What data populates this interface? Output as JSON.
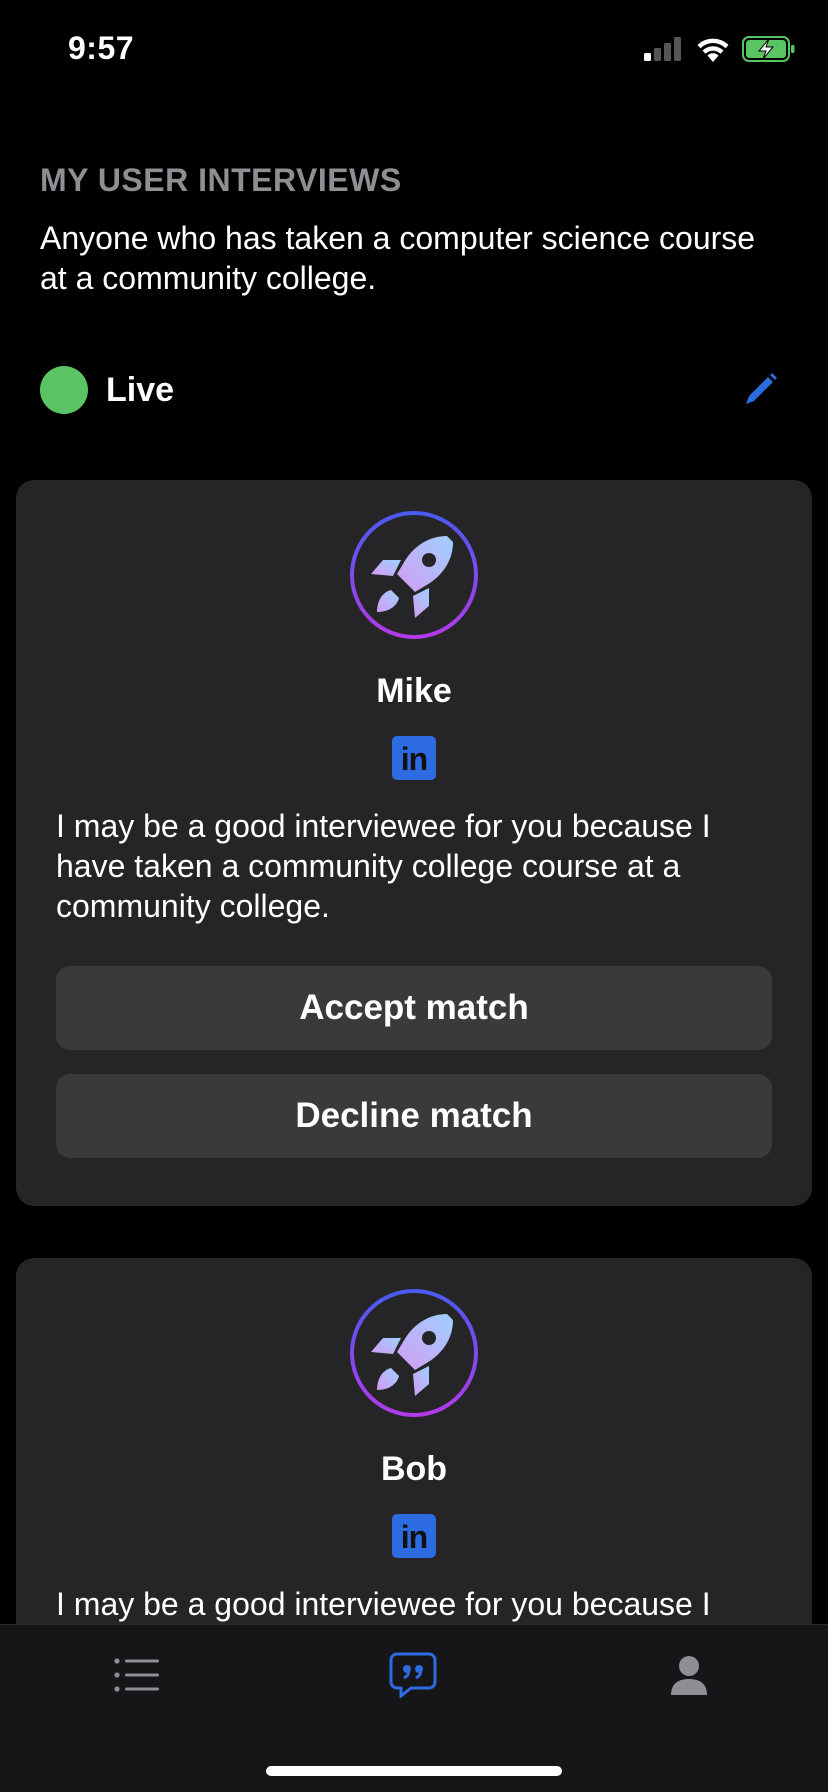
{
  "status_bar": {
    "time": "9:57"
  },
  "header": {
    "section_label": "MY USER INTERVIEWS",
    "description": "Anyone who has taken a computer science course at a community college.",
    "status_label": "Live"
  },
  "matches": [
    {
      "name": "Mike",
      "pitch": "I may be a good interviewee for you because I have taken a community college course at a community college.",
      "accept_label": "Accept match",
      "decline_label": "Decline match"
    },
    {
      "name": "Bob",
      "pitch": "I may be a good interviewee for you because I"
    }
  ],
  "linkedin_text": "in",
  "icons": {
    "edit": "pencil-icon",
    "avatar": "rocket-icon",
    "tab_list": "list-icon",
    "tab_chat": "quote-bubble-icon",
    "tab_profile": "person-icon"
  },
  "colors": {
    "live": "#5ac463",
    "accent": "#2d6be0",
    "card": "#252527",
    "button": "#3a3a3d"
  }
}
